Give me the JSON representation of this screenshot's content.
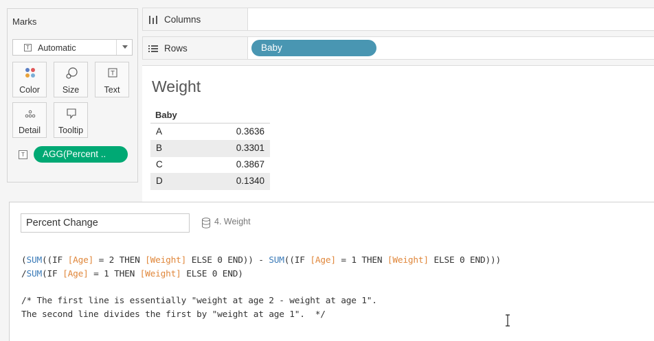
{
  "marks": {
    "title": "Marks",
    "mark_type": "Automatic",
    "buttons": [
      {
        "label": "Color",
        "icon": "color-dots-icon"
      },
      {
        "label": "Size",
        "icon": "size-icon"
      },
      {
        "label": "Text",
        "icon": "text-icon"
      },
      {
        "label": "Detail",
        "icon": "detail-dots-icon"
      },
      {
        "label": "Tooltip",
        "icon": "tooltip-icon"
      }
    ],
    "measure_pill": "AGG(Percent .."
  },
  "shelves": {
    "columns_label": "Columns",
    "rows_label": "Rows",
    "rows_pill": "Baby"
  },
  "viz": {
    "title": "Weight",
    "table_header": "Baby",
    "rows": [
      {
        "key": "A",
        "value": "0.3636"
      },
      {
        "key": "B",
        "value": "0.3301"
      },
      {
        "key": "C",
        "value": "0.3867"
      },
      {
        "key": "D",
        "value": "0.1340"
      }
    ]
  },
  "calc": {
    "name": "Percent Change",
    "datasource": "4. Weight",
    "code": {
      "l1": [
        {
          "t": "(",
          "c": ""
        },
        {
          "t": "SUM",
          "c": "fn"
        },
        {
          "t": "((IF ",
          "c": ""
        },
        {
          "t": "[Age]",
          "c": "fld"
        },
        {
          "t": " = 2 THEN ",
          "c": ""
        },
        {
          "t": "[Weight]",
          "c": "fld"
        },
        {
          "t": " ELSE 0 END)) - ",
          "c": ""
        },
        {
          "t": "SUM",
          "c": "fn"
        },
        {
          "t": "((IF ",
          "c": ""
        },
        {
          "t": "[Age]",
          "c": "fld"
        },
        {
          "t": " = 1 THEN ",
          "c": ""
        },
        {
          "t": "[Weight]",
          "c": "fld"
        },
        {
          "t": " ELSE 0 END)))",
          "c": ""
        }
      ],
      "l2": [
        {
          "t": "/",
          "c": ""
        },
        {
          "t": "SUM",
          "c": "fn"
        },
        {
          "t": "(IF ",
          "c": ""
        },
        {
          "t": "[Age]",
          "c": "fld"
        },
        {
          "t": " = 1 THEN ",
          "c": ""
        },
        {
          "t": "[Weight]",
          "c": "fld"
        },
        {
          "t": " ELSE 0 END)",
          "c": ""
        }
      ],
      "l3": "/* The first line is essentially \"weight at age 2 - weight at age 1\".",
      "l4": "The second line divides the first by \"weight at age 1\".  */"
    }
  },
  "colors": {
    "measure_pill": "#00a974",
    "dimension_pill": "#4996b2",
    "function": "#3b7bb8",
    "field": "#e0873b"
  }
}
